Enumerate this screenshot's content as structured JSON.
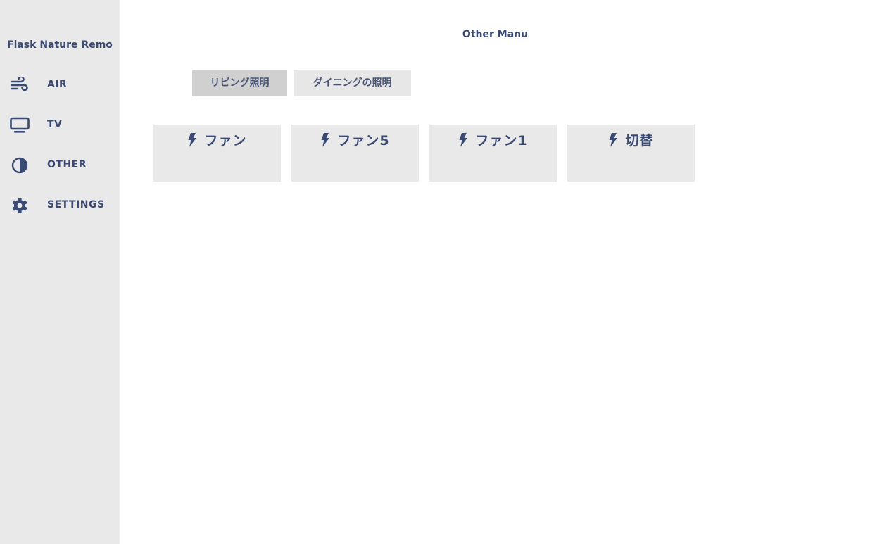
{
  "app": {
    "brand": "Flask Nature Remo",
    "accent_color": "#3a4a73",
    "sidebar_bg": "#e9e9e9"
  },
  "sidebar": {
    "items": [
      {
        "label": "AIR",
        "icon": "wind-icon"
      },
      {
        "label": "TV",
        "icon": "monitor-icon"
      },
      {
        "label": "OTHER",
        "icon": "contrast-icon"
      },
      {
        "label": "SETTINGS",
        "icon": "gear-icon"
      }
    ]
  },
  "main": {
    "title": "Other Manu",
    "tabs": [
      {
        "label": "リビング照明",
        "active": true
      },
      {
        "label": "ダイニングの照明",
        "active": false
      }
    ],
    "buttons": [
      {
        "label": "ファン",
        "icon": "lightning-icon"
      },
      {
        "label": "ファン5",
        "icon": "lightning-icon"
      },
      {
        "label": "ファン1",
        "icon": "lightning-icon"
      },
      {
        "label": "切替",
        "icon": "lightning-icon"
      }
    ]
  }
}
